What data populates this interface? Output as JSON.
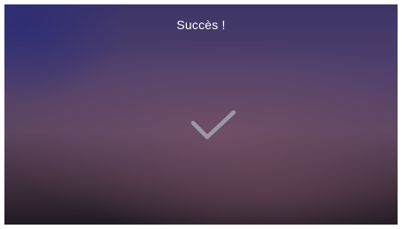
{
  "screen": {
    "title": "Succès !",
    "icon": "checkmark-icon",
    "colors": {
      "title_text": "#ffffff",
      "check_stroke": "#9a9aa6",
      "background_top_left": "#2a2c78",
      "background_mid": "#5c4560",
      "background_bottom": "#201a22"
    }
  }
}
